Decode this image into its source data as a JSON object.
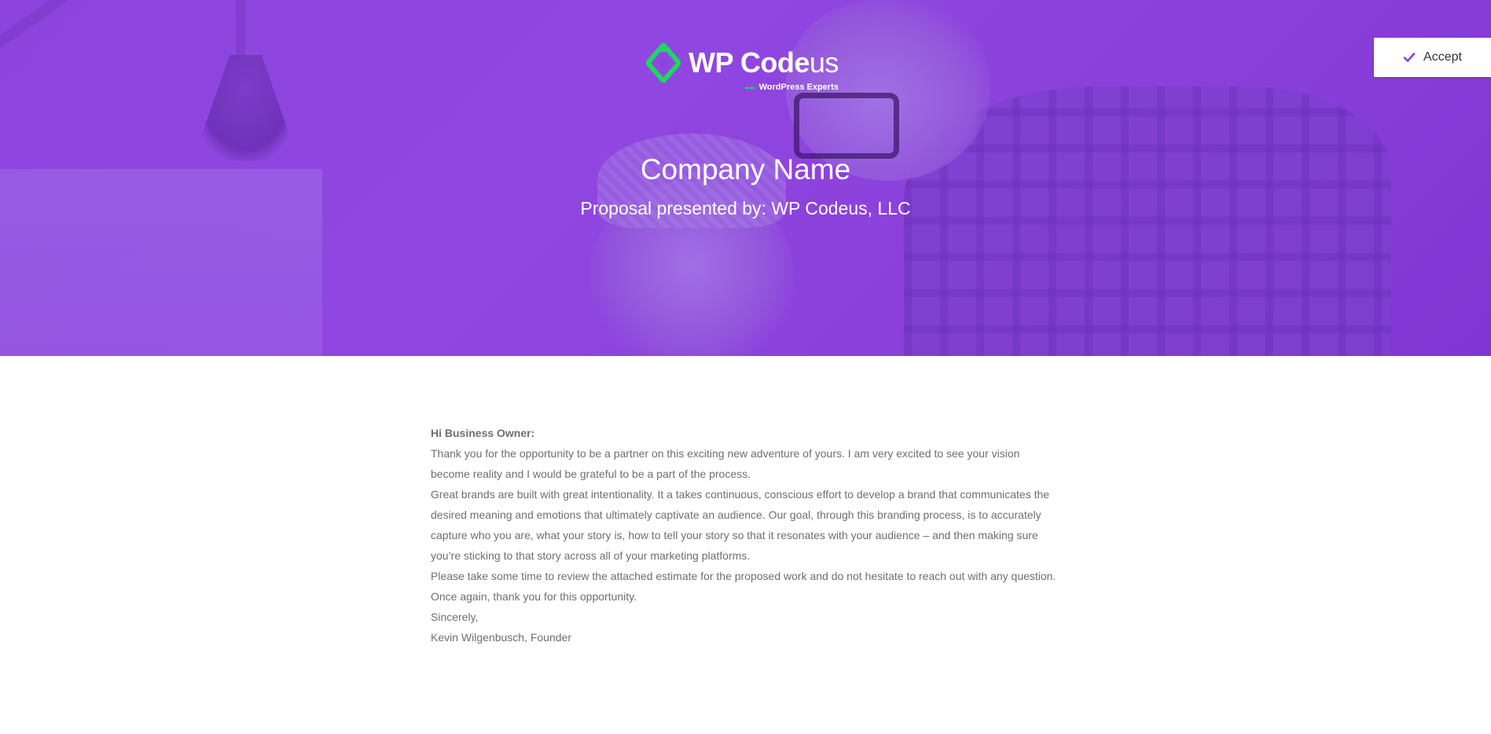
{
  "brand": {
    "logo_word_bold": "WP Code",
    "logo_word_light": "us",
    "logo_tagline": "WordPress Experts",
    "accent_color": "#1ed760",
    "hero_color": "#8d44dd"
  },
  "header": {
    "title": "Company Name",
    "subtitle": "Proposal presented by: WP Codeus, LLC"
  },
  "actions": {
    "accept_label": "Accept",
    "accept_icon": "check-icon",
    "accept_icon_color": "#8a3fd9"
  },
  "letter": {
    "greeting": "Hi Business Owner:",
    "paragraph_1": "Thank you for the opportunity to be a partner on this exciting new adventure of yours. I am very excited to see your vision become reality and I would be grateful to be a part of the process.",
    "paragraph_2": "Great brands are built with great intentionality. It a takes continuous, conscious effort to develop a brand that communicates the desired meaning and emotions that ultimately captivate an audience. Our goal, through this branding process, is to accurately capture who you are, what your story is, how to tell your story so that it resonates with your audience – and then making sure you’re sticking to that story across all of your marketing platforms.",
    "paragraph_3": "Please take some time to review the attached estimate for the proposed work and do not hesitate to reach out with any question.",
    "paragraph_4": "Once again, thank you for this opportunity.",
    "closing": "Sincerely,",
    "signature": "Kevin Wilgenbusch, Founder"
  }
}
